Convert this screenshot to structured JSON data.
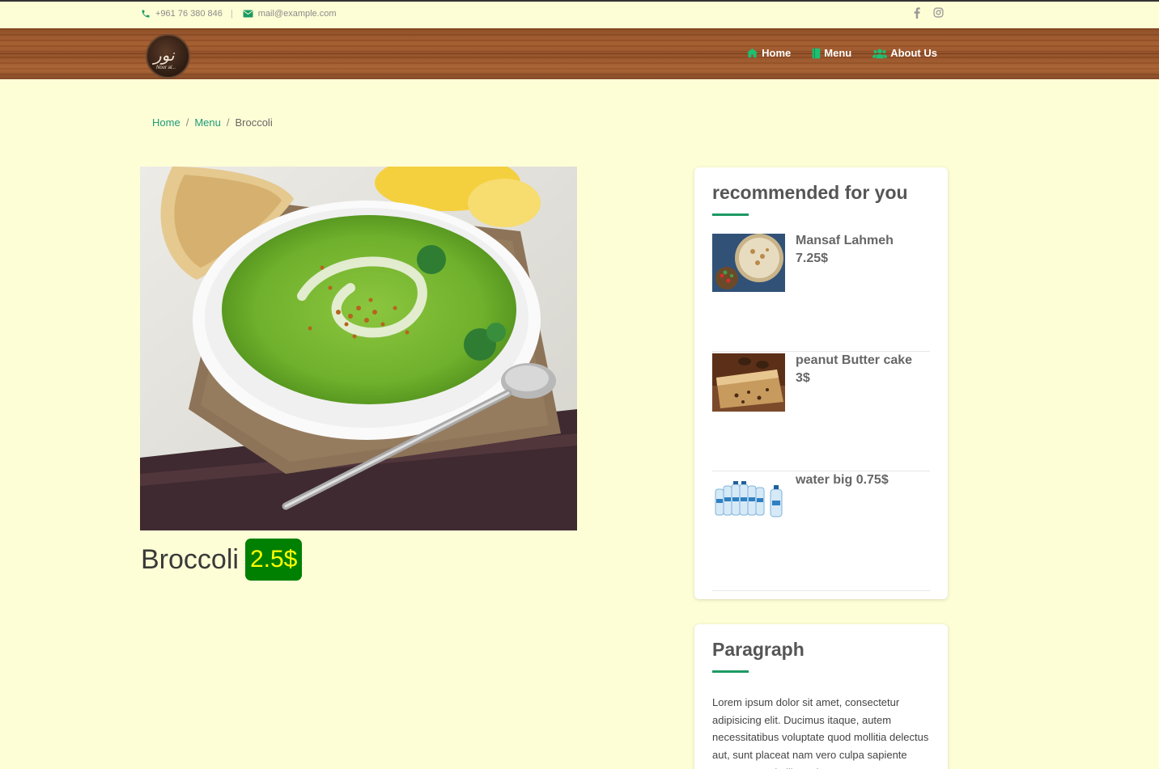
{
  "topbar": {
    "phone": "+961 76 380 846",
    "separator": "|",
    "email": "mail@example.com",
    "social": [
      "facebook-icon",
      "instagram-icon"
    ]
  },
  "header": {
    "logo_alt": "restaurant-logo",
    "logo_script": "Nour al...",
    "nav": [
      {
        "label": "Home",
        "icon": "home-icon"
      },
      {
        "label": "Menu",
        "icon": "menu-book-icon"
      },
      {
        "label": "About Us",
        "icon": "users-icon"
      }
    ]
  },
  "breadcrumb": {
    "items": [
      "Home",
      "Menu"
    ],
    "separator": "/",
    "current": "Broccoli"
  },
  "product": {
    "name": "Broccoli",
    "price": "2.5$",
    "image": "broccoli-soup-photo"
  },
  "sidebar": {
    "recommended_title": "recommended for you",
    "items": [
      {
        "name": "Mansaf Lahmeh",
        "price": "7.25$",
        "image": "mansaf-photo"
      },
      {
        "name": "peanut Butter cake",
        "price": "3$",
        "image": "cake-photo"
      },
      {
        "name": "water big",
        "price": "0.75$",
        "image": "water-bottles-photo"
      }
    ],
    "paragraph_title": "Paragraph",
    "paragraph_text": "Lorem ipsum dolor sit amet, consectetur adipisicing elit. Ducimus itaque, autem necessitatibus voluptate quod mollitia delectus aut, sunt placeat nam vero culpa sapiente consectetur similique, inventore"
  },
  "colors": {
    "background": "#fefed6",
    "accent": "#1c9a63",
    "price_bg": "#008000",
    "price_text": "#ffff00"
  }
}
